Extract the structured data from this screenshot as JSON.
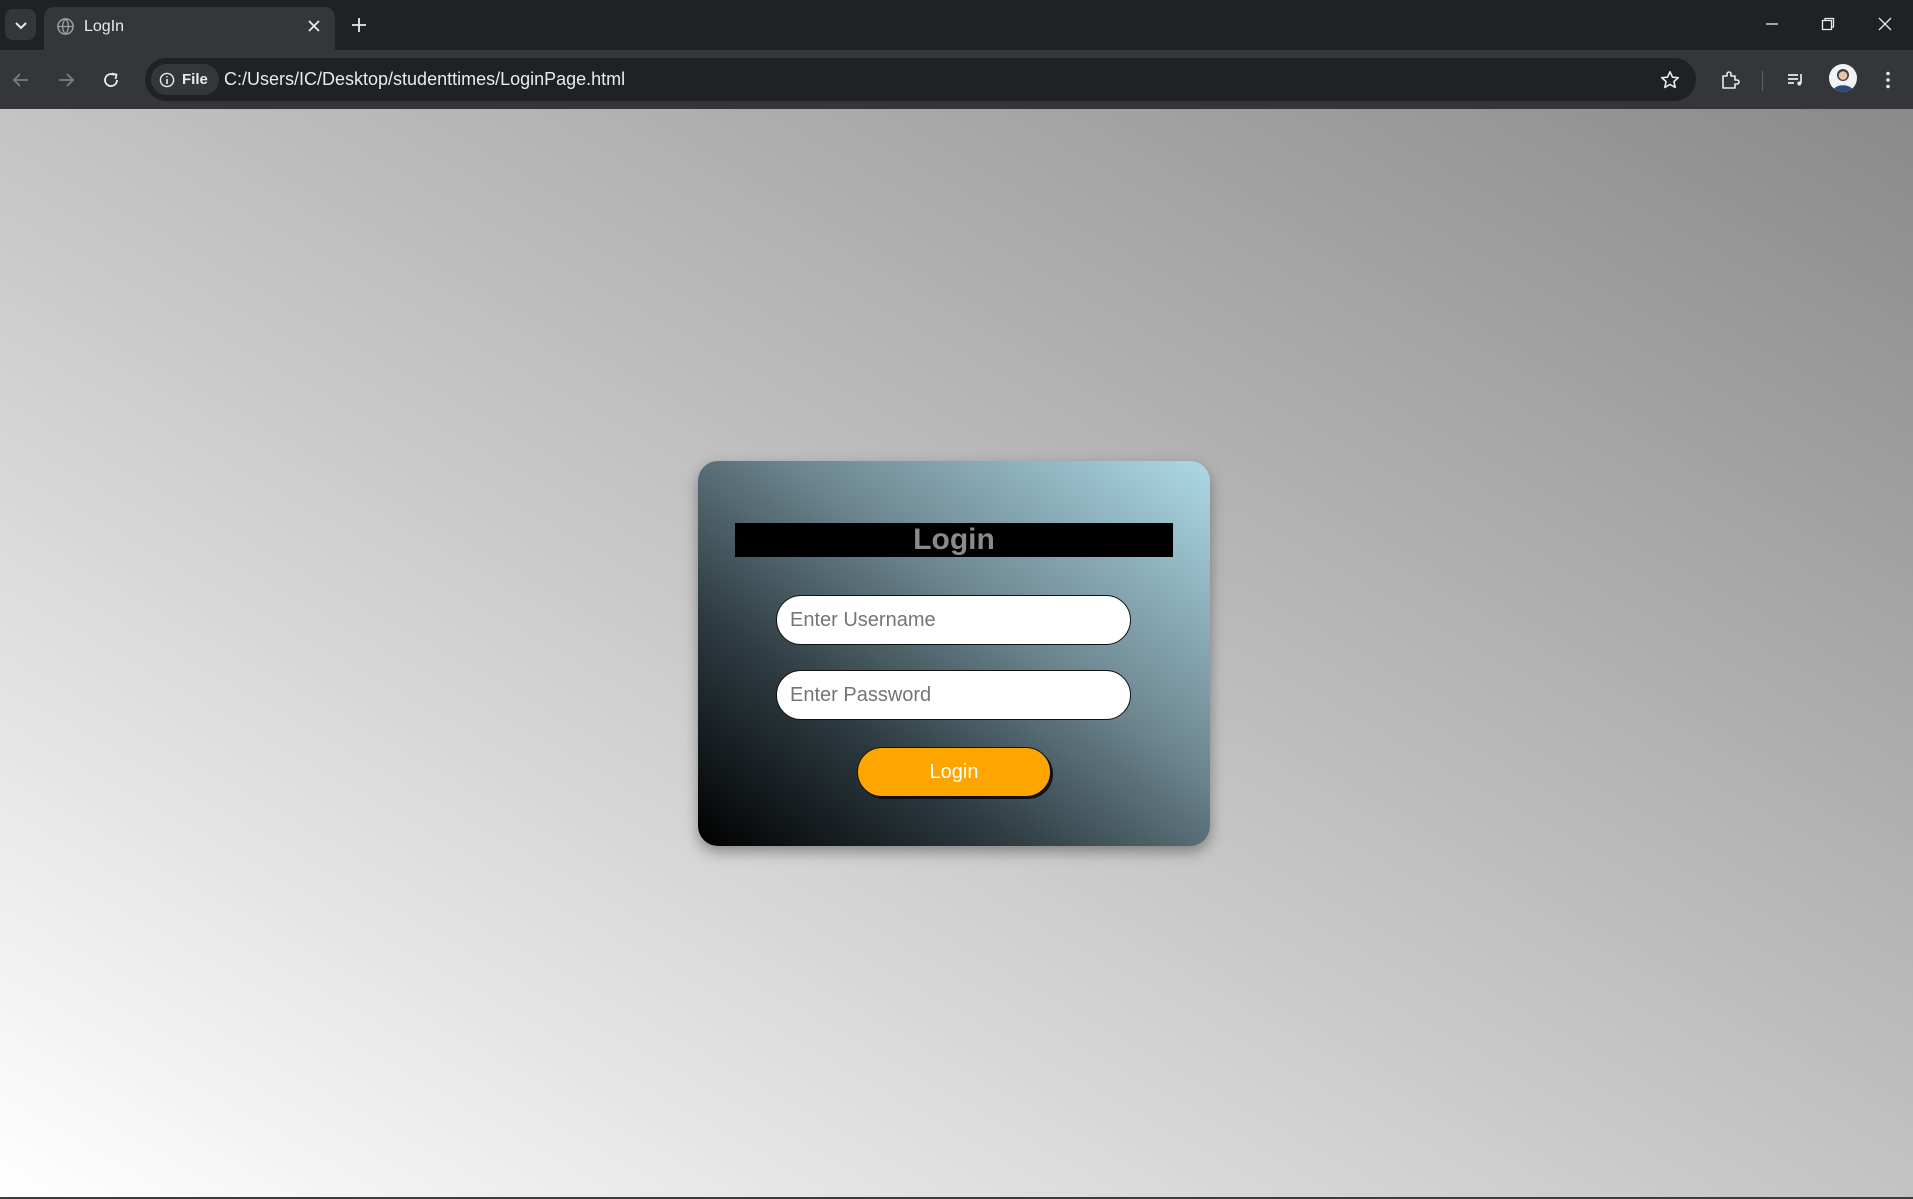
{
  "tab": {
    "title": "LogIn",
    "close_symbol": "✕",
    "favicon_icon": "globe-icon"
  },
  "toolbar": {
    "site_chip_label": "File",
    "url": "C:/Users/IC/Desktop/studenttimes/LoginPage.html"
  },
  "page": {
    "heading": "Login",
    "username_placeholder": "Enter Username",
    "password_placeholder": "Enter Password",
    "login_button": "Login"
  },
  "colors": {
    "button_accent": "#ffa500",
    "chrome_dark": "#202124",
    "chrome_toolbar": "#35363a",
    "heading_bg": "#000000",
    "heading_text": "#8a8a8a"
  }
}
